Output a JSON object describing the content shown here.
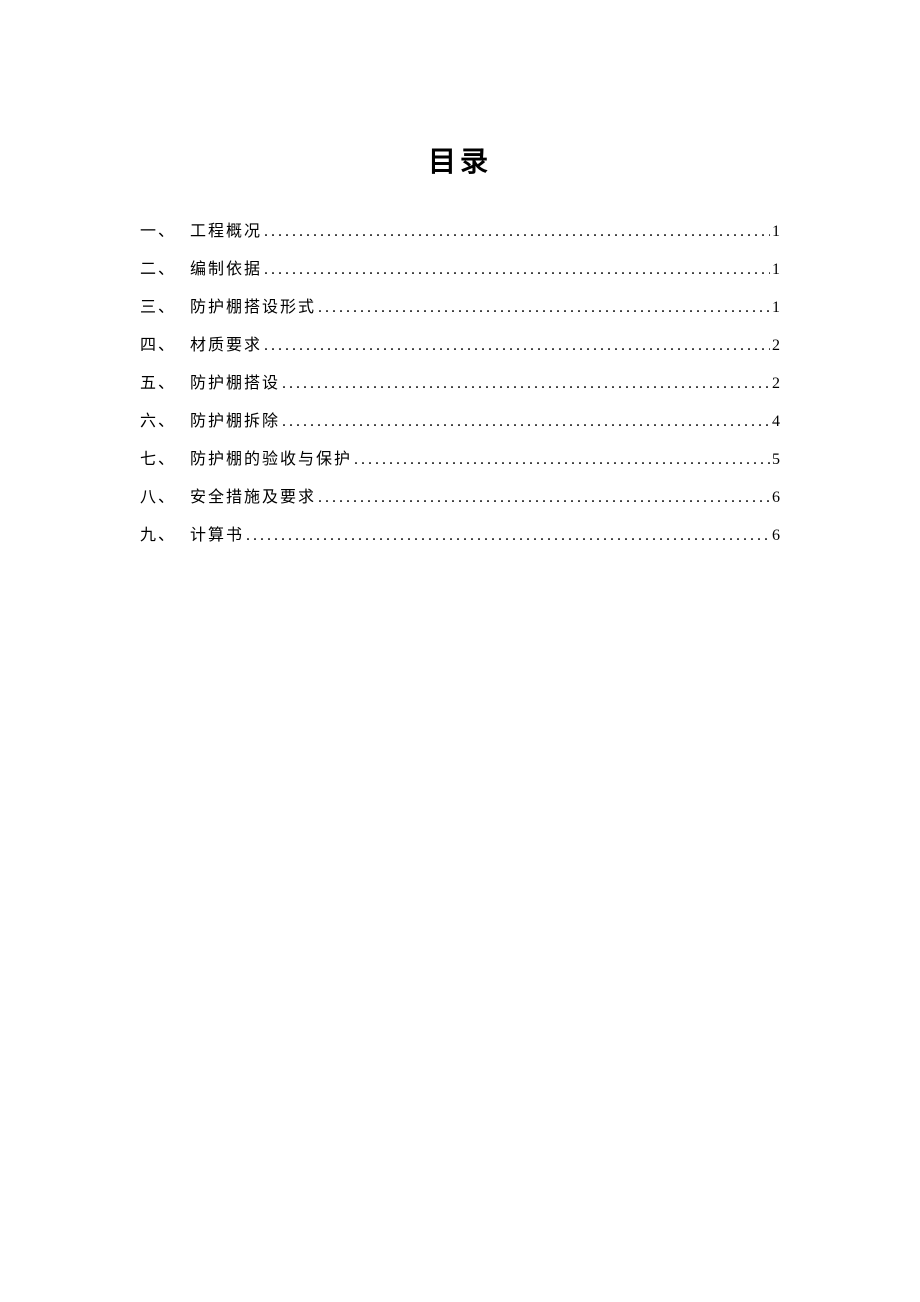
{
  "title": "目录",
  "toc": [
    {
      "num": "一、",
      "label": "工程概况",
      "page": "1"
    },
    {
      "num": "二、",
      "label": "编制依据",
      "page": "1"
    },
    {
      "num": "三、",
      "label": "防护棚搭设形式",
      "page": "1"
    },
    {
      "num": "四、",
      "label": "材质要求",
      "page": "2"
    },
    {
      "num": "五、",
      "label": "防护棚搭设",
      "page": "2"
    },
    {
      "num": "六、",
      "label": "防护棚拆除",
      "page": "4"
    },
    {
      "num": "七、",
      "label": "防护棚的验收与保护",
      "page": "5"
    },
    {
      "num": "八、",
      "label": "安全措施及要求",
      "page": "6"
    },
    {
      "num": "九、",
      "label": "计算书",
      "page": "6"
    }
  ]
}
